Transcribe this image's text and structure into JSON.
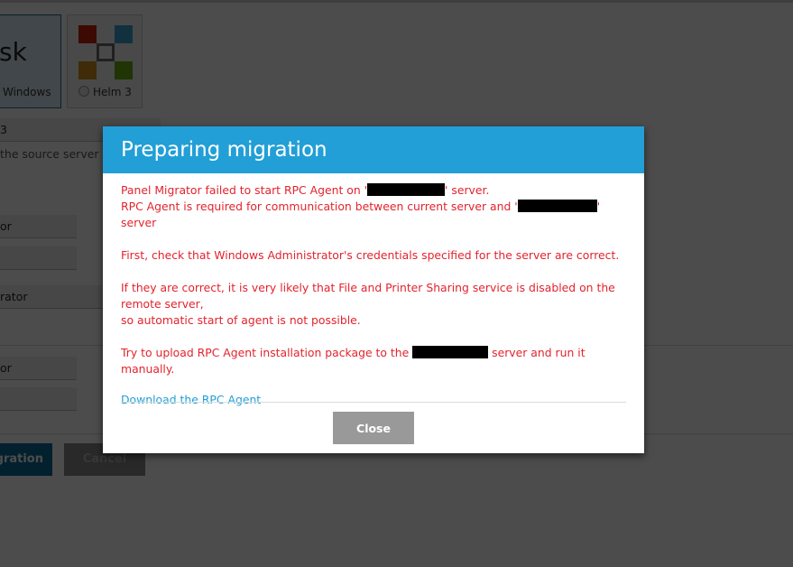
{
  "background": {
    "tiles": [
      {
        "big_text": "sk",
        "label": "Windows",
        "selected": true
      },
      {
        "label": "Helm 3",
        "selected": false,
        "icon": "helm-logo-icon"
      }
    ],
    "fields": [
      {
        "value": "3"
      },
      {
        "value": "or"
      },
      {
        "value": ""
      },
      {
        "value": "rator"
      },
      {
        "value": "or"
      },
      {
        "value": ""
      }
    ],
    "hint": "the source server",
    "buttons": {
      "start_migration": "gration",
      "cancel": "Cancel"
    }
  },
  "modal": {
    "title": "Preparing migration",
    "messages": {
      "line1_a": "Panel Migrator failed to start RPC Agent on '",
      "line1_b": "' server.",
      "line2_a": "RPC Agent is required for communication between current server and '",
      "line2_b": "' server",
      "para2": "First, check that Windows Administrator's credentials specified for the server are correct.",
      "para3_a": "If they are correct, it is very likely that File and Printer Sharing service is disabled on the remote server,",
      "para3_b": "so automatic start of agent is not possible.",
      "para4_a": "Try to upload RPC Agent installation package to the ",
      "para4_b": " server and run it manually."
    },
    "download_link": "Download the RPC Agent",
    "close_label": "Close",
    "colors": {
      "header": "#229fd6",
      "error_text": "#e3232d",
      "link": "#229fd6"
    }
  }
}
